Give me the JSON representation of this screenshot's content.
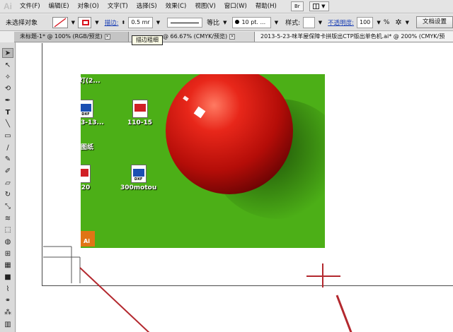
{
  "app": {
    "logo": "Ai"
  },
  "menu": {
    "items": [
      "文件(F)",
      "编辑(E)",
      "对象(O)",
      "文字(T)",
      "选择(S)",
      "效果(C)",
      "视图(V)",
      "窗口(W)",
      "帮助(H)"
    ],
    "bridge_label": "Br"
  },
  "control": {
    "selection_label": "未选择对象",
    "stroke_label": "描边:",
    "stroke_weight": "0.5 mr",
    "profile_label": "等比",
    "brush_label": "10 pt. ...",
    "style_label": "样式:",
    "opacity_label": "不透明度:",
    "opacity_value": "100",
    "opacity_unit": "%",
    "doc_setup_button": "文档设置"
  },
  "tabs": [
    {
      "label": "未标题-1* @ 100% (RGB/预览)"
    },
    {
      "label": "@ 66.67% (CMYK/预览)"
    },
    {
      "label": "2013-5-23-咪羊屋保障卡拼版出CTP版出单色机.ai* @ 200% (CMYK/预"
    }
  ],
  "tooltip": "描边粗细",
  "desktop_icons": [
    {
      "label": "灯(2..."
    },
    {
      "label": "3-13..."
    },
    {
      "label": "110-15"
    },
    {
      "label": "图纸"
    },
    {
      "label": "20"
    },
    {
      "label": "300motou"
    }
  ],
  "icon_tags": {
    "dxf": "DXF",
    "ai": "Ai"
  },
  "colors": {
    "stroke_swatch": "#d8141e",
    "crop_line": "#b3282e",
    "photo_bg": "#4caf17",
    "ball": "#d81e14"
  }
}
